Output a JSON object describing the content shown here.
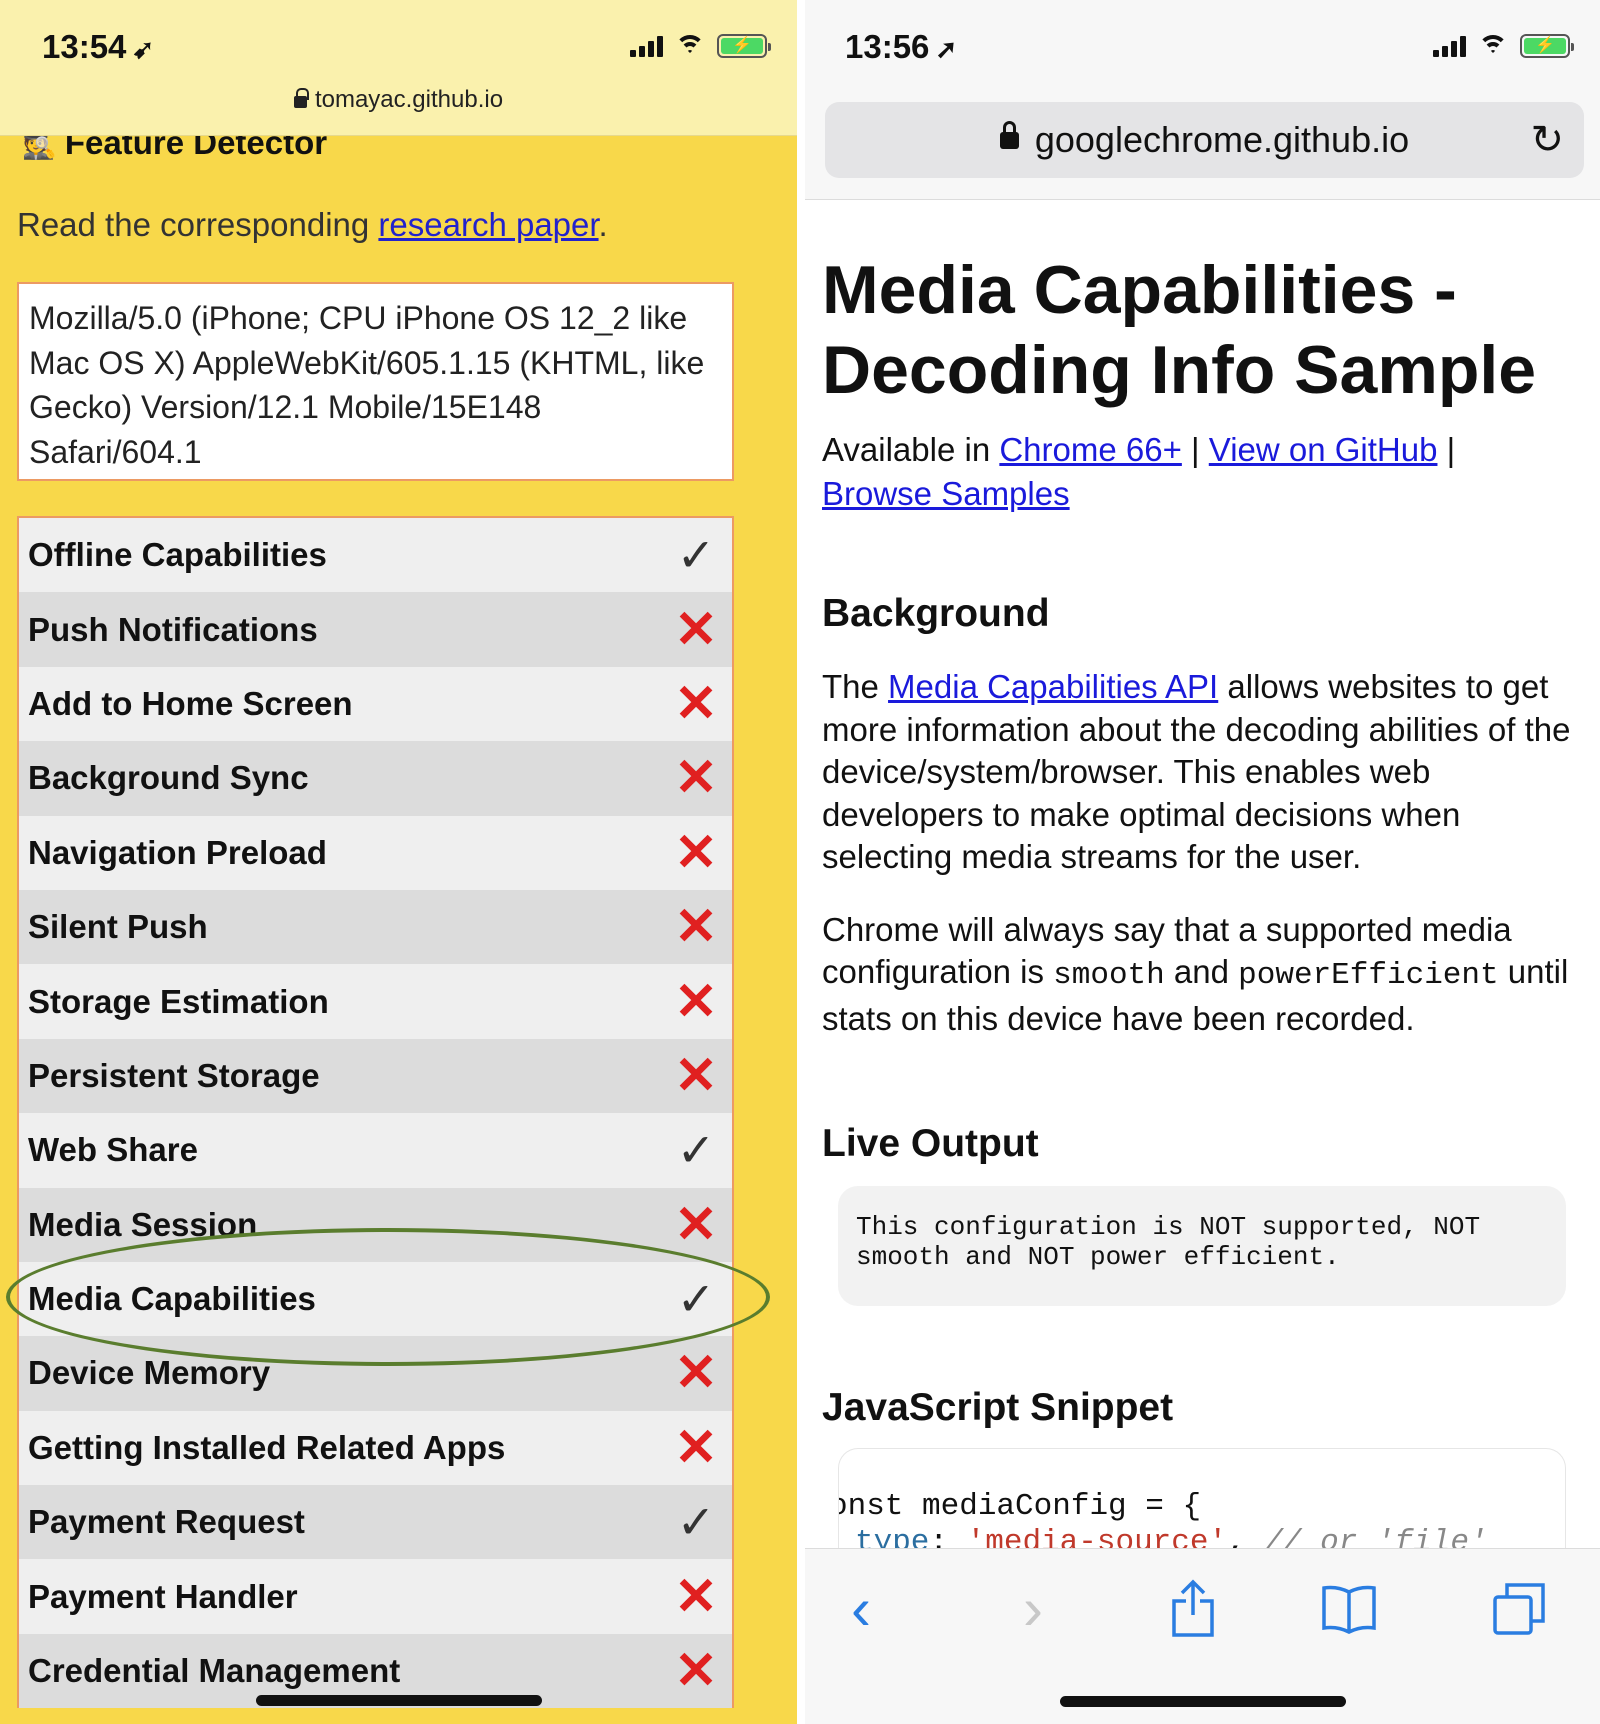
{
  "left_phone": {
    "status_time": "13:54",
    "url": "tomayac.github.io",
    "app_title": "Feature Detector",
    "intro_text": "Read the corresponding ",
    "intro_link": "research paper",
    "intro_end": ".",
    "user_agent": "Mozilla/5.0 (iPhone; CPU iPhone OS 12_2 like Mac OS X) AppleWebKit/605.1.15 (KHTML, like Gecko) Version/12.1 Mobile/15E148 Safari/604.1",
    "features": [
      {
        "name": "Offline Capabilities",
        "supported": true
      },
      {
        "name": "Push Notifications",
        "supported": false
      },
      {
        "name": "Add to Home Screen",
        "supported": false
      },
      {
        "name": "Background Sync",
        "supported": false
      },
      {
        "name": "Navigation Preload",
        "supported": false
      },
      {
        "name": "Silent Push",
        "supported": false
      },
      {
        "name": "Storage Estimation",
        "supported": false
      },
      {
        "name": "Persistent Storage",
        "supported": false
      },
      {
        "name": "Web Share",
        "supported": true
      },
      {
        "name": "Media Session",
        "supported": false
      },
      {
        "name": "Media Capabilities",
        "supported": true
      },
      {
        "name": "Device Memory",
        "supported": false
      },
      {
        "name": "Getting Installed Related Apps",
        "supported": false
      },
      {
        "name": "Payment Request",
        "supported": true
      },
      {
        "name": "Payment Handler",
        "supported": false
      },
      {
        "name": "Credential Management",
        "supported": false
      }
    ],
    "highlighted_feature": "Media Capabilities",
    "check_glyph": "✓",
    "cross_glyph": "✕",
    "background_color": "#f8d84a",
    "cross_color": "#e02020",
    "highlight_color": "#5a7d2e"
  },
  "right_phone": {
    "status_time": "13:56",
    "url": "googlechrome.github.io",
    "page_title": "Media Capabilities - Decoding Info Sample",
    "available_prefix": "Available in ",
    "link_chrome": "Chrome 66+",
    "separator": " | ",
    "link_github": "View on GitHub",
    "link_samples": "Browse Samples",
    "background_heading": "Background",
    "bg_para1_prefix": "The ",
    "bg_para1_link": "Media Capabilities API",
    "bg_para1_rest": " allows websites to get more information about the decoding abilities of the device/system/browser. This enables web developers to make optimal decisions when selecting media streams for the user.",
    "bg_para2_a": "Chrome will always say that a supported media configuration is ",
    "bg_para2_code1": "smooth",
    "bg_para2_b": " and ",
    "bg_para2_code2": "powerEfficient",
    "bg_para2_c": " until stats on this device have been recorded.",
    "live_heading": "Live Output",
    "live_output": "This configuration is NOT supported, NOT smooth and NOT power efficient.",
    "js_heading": "JavaScript Snippet",
    "code_line1": "onst mediaConfig = {",
    "code_line2_key": "type",
    "code_line2_colon": ": ",
    "code_line2_str": "'media-source'",
    "code_line2_comma": ", ",
    "code_line2_comment": "// or 'file'",
    "link_color": "#1a1adb",
    "toolbar_accent": "#2a7de1"
  }
}
